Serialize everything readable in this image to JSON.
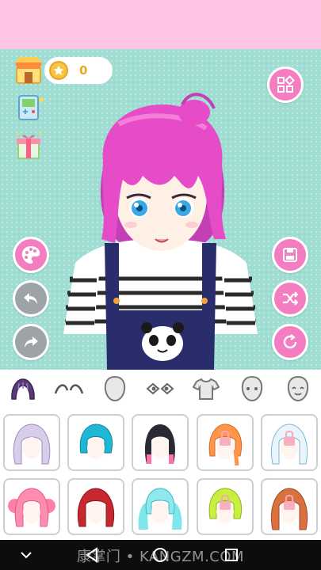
{
  "coins": {
    "value": "0"
  },
  "watermark": {
    "text": "康掌门 • KANGZM.COM"
  },
  "colors": {
    "accent_pink": "#f47cc0",
    "top_band": "#ffc4e3",
    "stage_bg": "#9fddd3",
    "gray_button": "#9ea3a7"
  },
  "left_panel": [
    "shop-icon",
    "game-console-icon",
    "gift-box-icon",
    "palette-icon",
    "undo-icon",
    "redo-icon"
  ],
  "right_panel": [
    "category-grid-icon",
    "save-icon",
    "shuffle-icon",
    "reset-icon"
  ],
  "categories": [
    "hair",
    "eyebrows",
    "face-shape",
    "eyes",
    "shirt",
    "head",
    "expression"
  ],
  "hair_items": [
    {
      "style": "wavy-lavender",
      "locked": false
    },
    {
      "style": "short-cyan",
      "locked": false
    },
    {
      "style": "black-pink-tips",
      "locked": false
    },
    {
      "style": "orange-braid",
      "locked": true
    },
    {
      "style": "white-blue-long",
      "locked": true
    },
    {
      "style": "pink-twintails",
      "locked": false
    },
    {
      "style": "red-bob",
      "locked": false
    },
    {
      "style": "cyan-twintails",
      "locked": false
    },
    {
      "style": "lime-green",
      "locked": true
    },
    {
      "style": "orange-long",
      "locked": true
    }
  ]
}
